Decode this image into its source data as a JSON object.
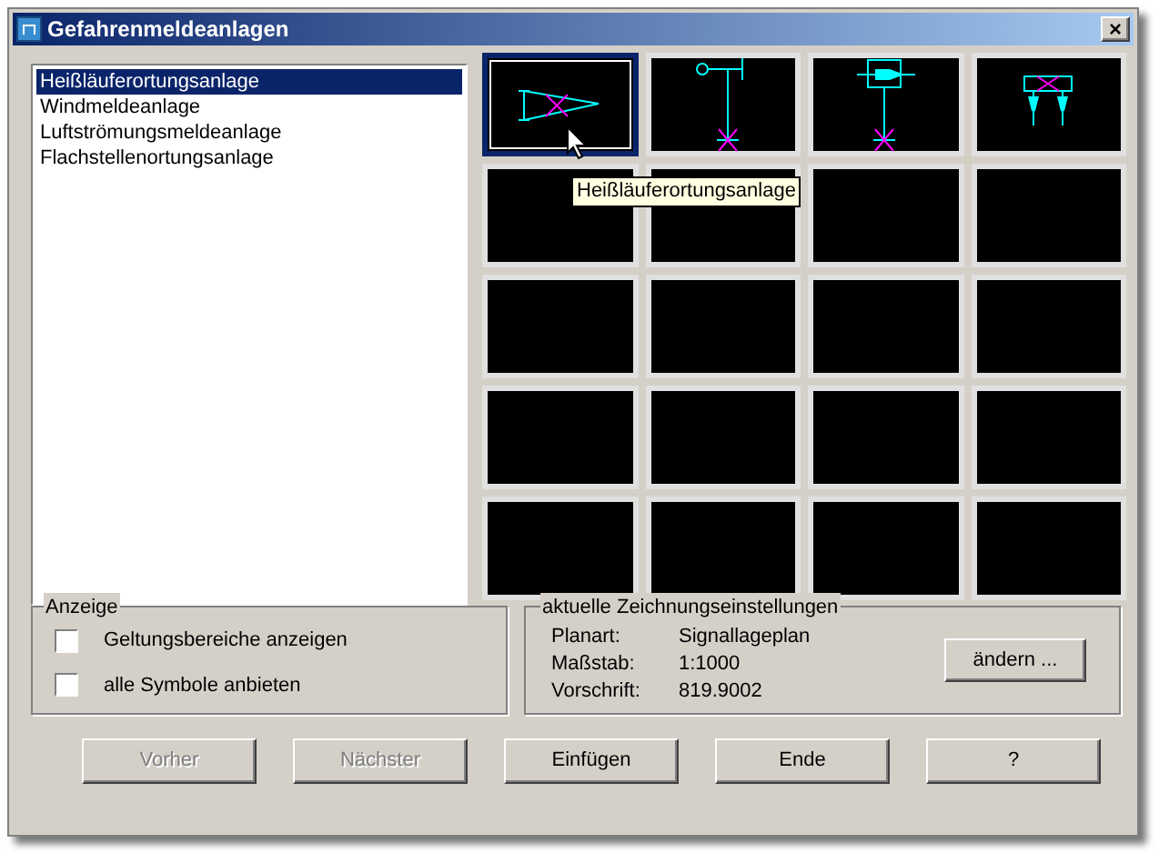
{
  "window": {
    "title": "Gefahrenmeldeanlagen",
    "close_label": "×"
  },
  "list": [
    {
      "label": "Heißläuferortungsanlage",
      "selected": true
    },
    {
      "label": "Windmeldeanlage",
      "selected": false
    },
    {
      "label": "Luftströmungsmeldeanlage",
      "selected": false
    },
    {
      "label": "Flachstellenortungsanlage",
      "selected": false
    }
  ],
  "symbols": [
    {
      "kind": "hotbox",
      "selected": true
    },
    {
      "kind": "wind",
      "selected": false
    },
    {
      "kind": "airflow",
      "selected": false
    },
    {
      "kind": "flatspot",
      "selected": false
    },
    {
      "kind": "empty",
      "selected": false
    },
    {
      "kind": "empty",
      "selected": false
    },
    {
      "kind": "empty",
      "selected": false
    },
    {
      "kind": "empty",
      "selected": false
    },
    {
      "kind": "empty",
      "selected": false
    },
    {
      "kind": "empty",
      "selected": false
    },
    {
      "kind": "empty",
      "selected": false
    },
    {
      "kind": "empty",
      "selected": false
    },
    {
      "kind": "empty",
      "selected": false
    },
    {
      "kind": "empty",
      "selected": false
    },
    {
      "kind": "empty",
      "selected": false
    },
    {
      "kind": "empty",
      "selected": false
    },
    {
      "kind": "empty",
      "selected": false
    },
    {
      "kind": "empty",
      "selected": false
    },
    {
      "kind": "empty",
      "selected": false
    },
    {
      "kind": "empty",
      "selected": false
    }
  ],
  "tooltip": "Heißläuferortungsanlage",
  "display_group": {
    "title": "Anzeige",
    "options": [
      {
        "label": "Geltungsbereiche anzeigen",
        "checked": false
      },
      {
        "label": "alle Symbole anbieten",
        "checked": false
      }
    ]
  },
  "settings_group": {
    "title": "aktuelle Zeichnungseinstellungen",
    "rows": [
      {
        "label": "Planart:",
        "value": "Signallageplan"
      },
      {
        "label": "Maßstab:",
        "value": "1:1000"
      },
      {
        "label": "Vorschrift:",
        "value": "819.9002"
      }
    ],
    "button": "ändern ..."
  },
  "buttons": [
    {
      "label": "Vorher",
      "disabled": true
    },
    {
      "label": "Nächster",
      "disabled": true
    },
    {
      "label": "Einfügen",
      "disabled": false
    },
    {
      "label": "Ende",
      "disabled": false
    },
    {
      "label": "?",
      "disabled": false
    }
  ]
}
